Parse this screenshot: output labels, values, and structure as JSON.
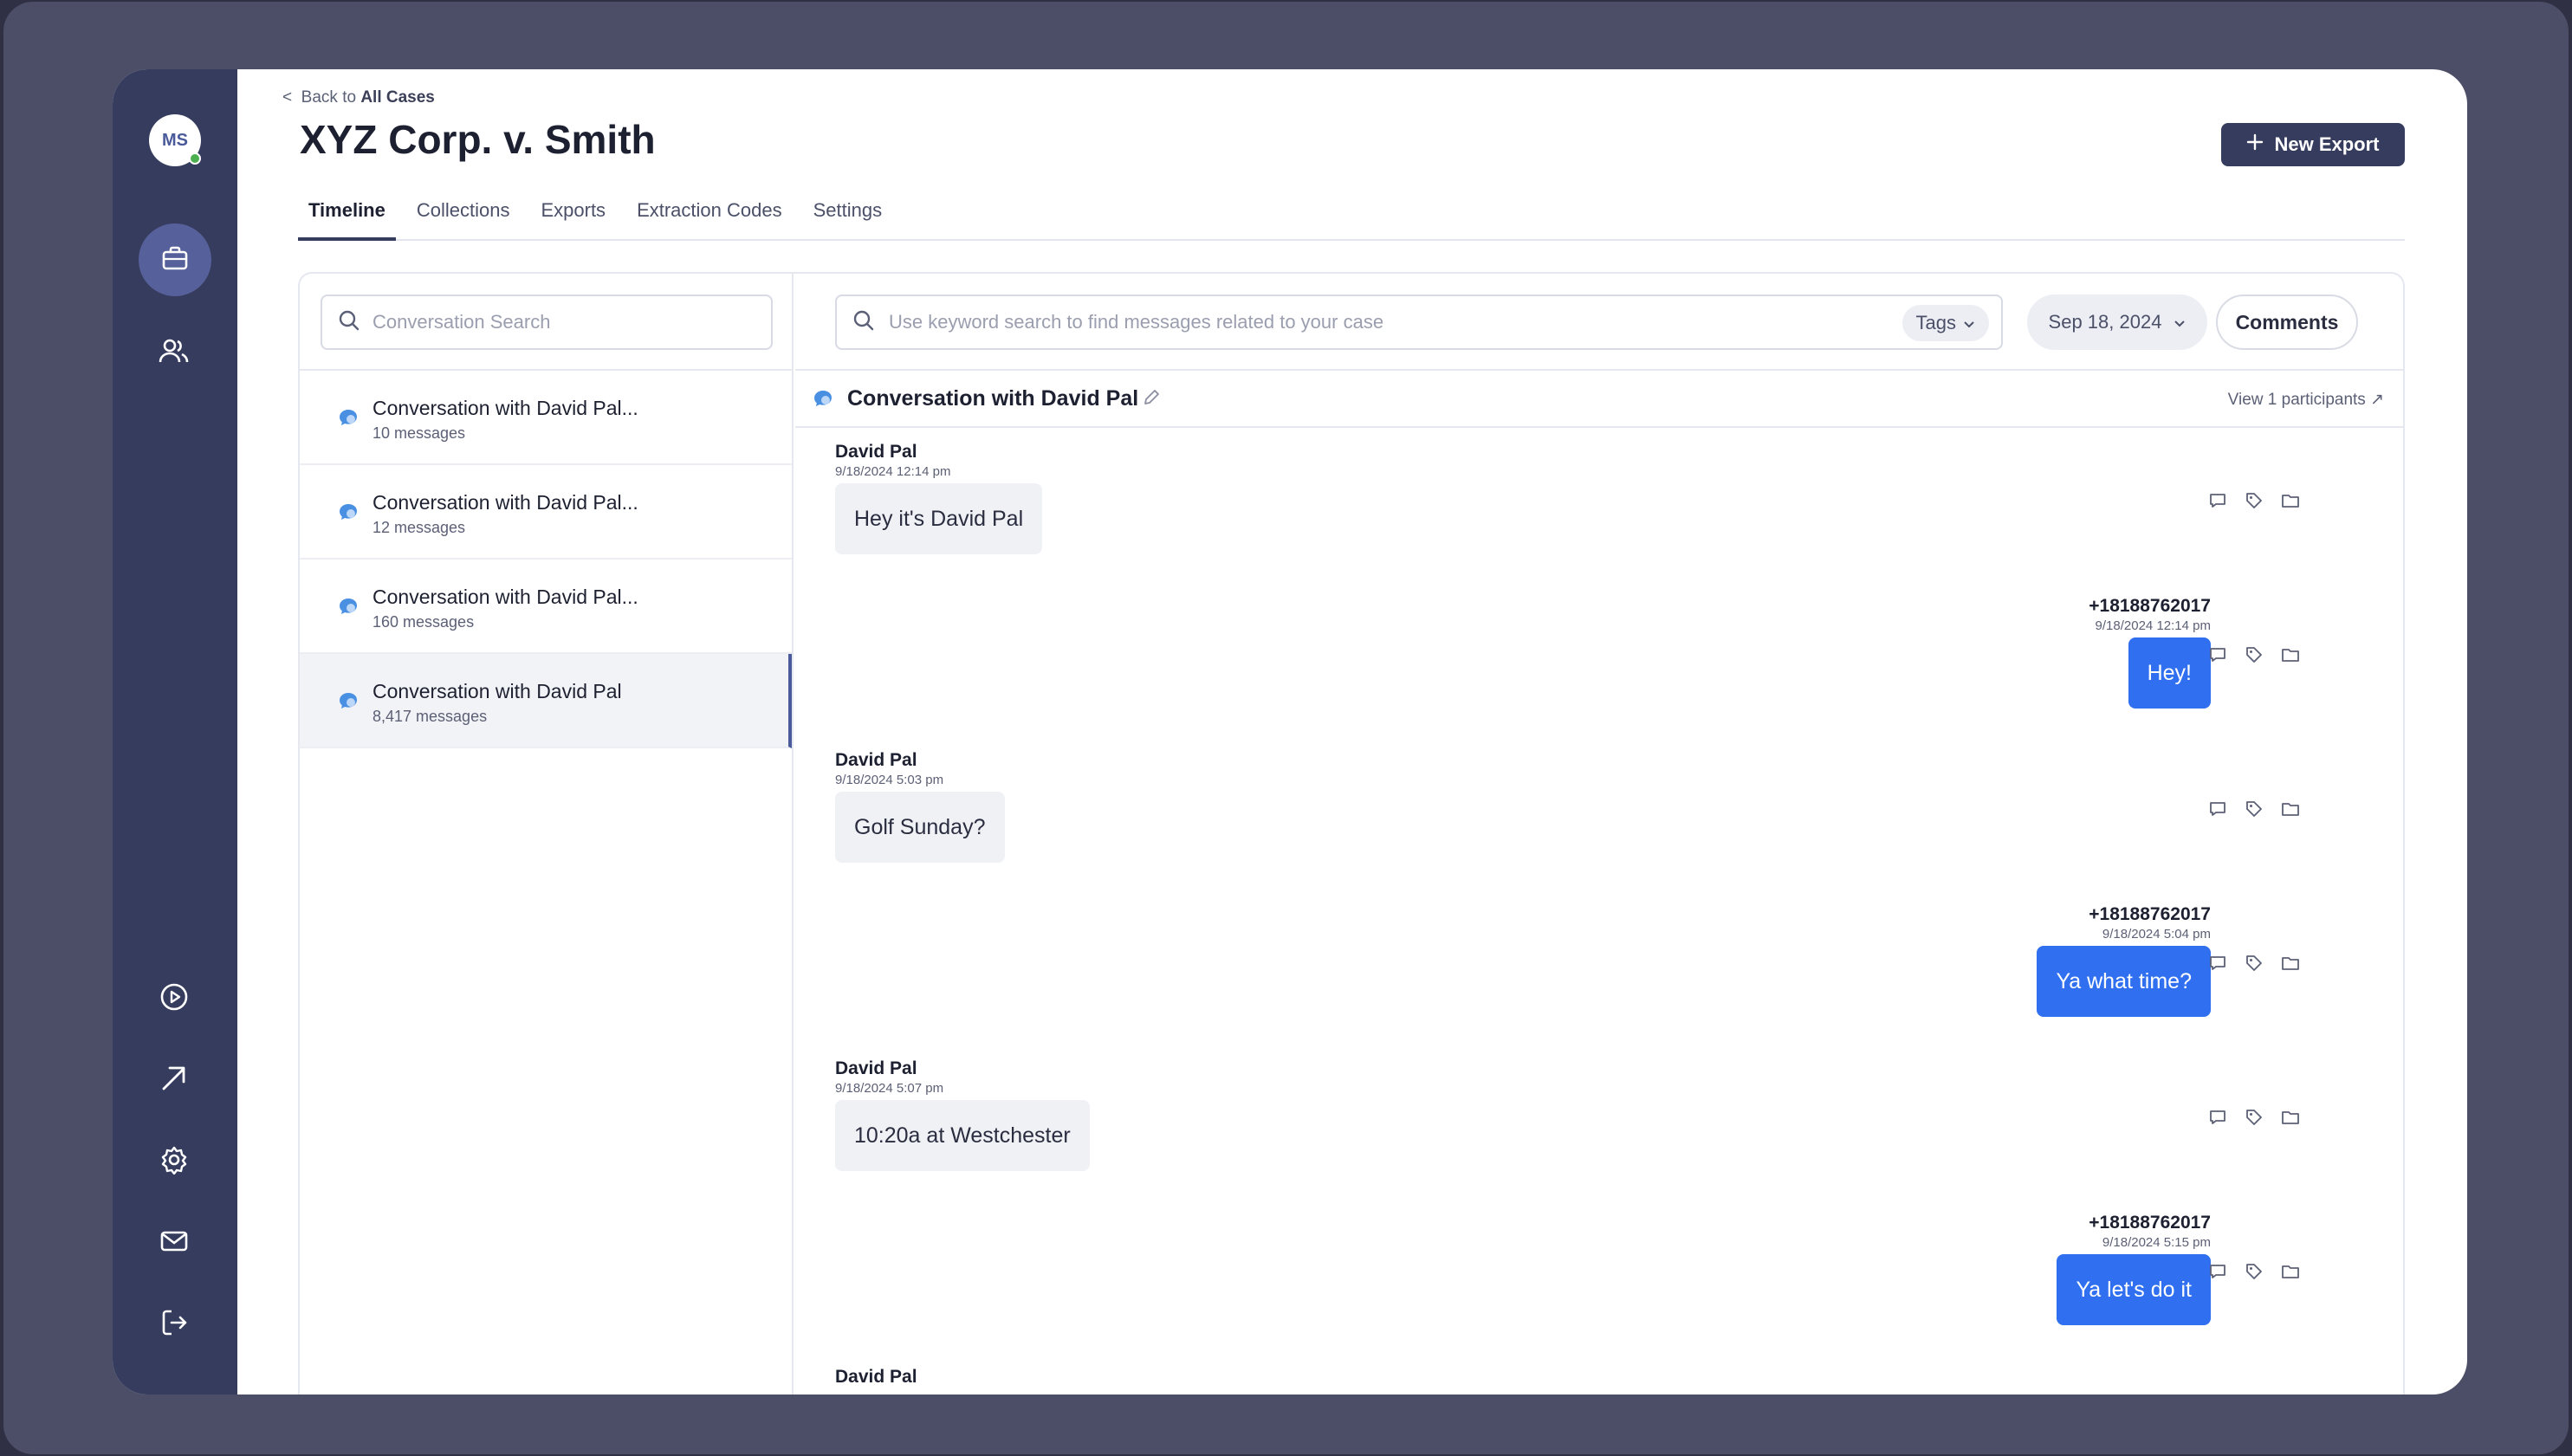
{
  "sidebar": {
    "avatar_initials": "MS",
    "icons": [
      "briefcase-icon",
      "users-icon",
      "play-circle-icon",
      "arrow-up-right-icon",
      "gear-icon",
      "mail-icon",
      "logout-icon"
    ]
  },
  "header": {
    "back_prefix": "Back to",
    "back_target": "All Cases",
    "title": "XYZ Corp. v. Smith",
    "new_export_label": "New Export"
  },
  "tabs": [
    {
      "label": "Timeline",
      "active": true
    },
    {
      "label": "Collections"
    },
    {
      "label": "Exports"
    },
    {
      "label": "Extraction Codes"
    },
    {
      "label": "Settings"
    }
  ],
  "conversations": {
    "search_placeholder": "Conversation Search",
    "items": [
      {
        "title": "Conversation with David Pal...",
        "count": "10 messages"
      },
      {
        "title": "Conversation with David Pal...",
        "count": "12 messages"
      },
      {
        "title": "Conversation with David Pal...",
        "count": "160 messages"
      },
      {
        "title": "Conversation with David Pal",
        "count": "8,417 messages",
        "selected": true
      }
    ]
  },
  "messages_pane": {
    "search_placeholder": "Use keyword search to find messages related to your case",
    "tags_label": "Tags",
    "date_label": "Sep 18, 2024",
    "comments_label": "Comments",
    "conversation_title": "Conversation with David Pal",
    "participants_link": "View 1 participants ↗",
    "messages": [
      {
        "sender": "David Pal",
        "time": "9/18/2024  12:14 pm",
        "text": "Hey it's David Pal",
        "direction": "in"
      },
      {
        "sender": "+18188762017",
        "time": "9/18/2024  12:14 pm",
        "text": "Hey!",
        "direction": "out"
      },
      {
        "sender": "David Pal",
        "time": "9/18/2024  5:03 pm",
        "text": "Golf Sunday?",
        "direction": "in"
      },
      {
        "sender": "+18188762017",
        "time": "9/18/2024  5:04 pm",
        "text": "Ya what time?",
        "direction": "out"
      },
      {
        "sender": "David Pal",
        "time": "9/18/2024  5:07 pm",
        "text": "10:20a at Westchester",
        "direction": "in"
      },
      {
        "sender": "+18188762017",
        "time": "9/18/2024  5:15 pm",
        "text": "Ya let's do it",
        "direction": "out"
      },
      {
        "sender": "David Pal",
        "direction": "in"
      }
    ]
  },
  "colors": {
    "sidebar": "#363c5e",
    "accent_blue": "#2f6ff0",
    "frame": "#4b4e66"
  }
}
